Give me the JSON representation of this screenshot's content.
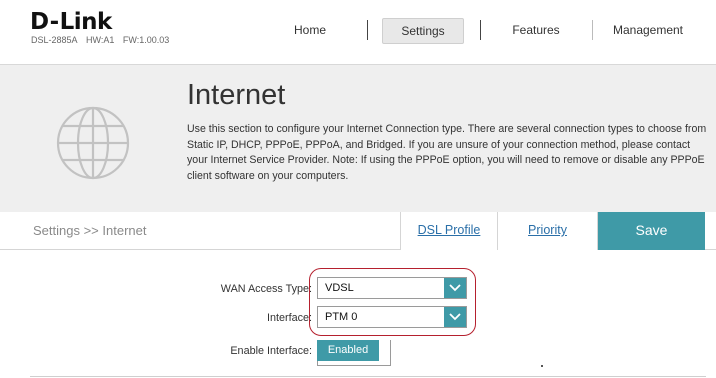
{
  "header": {
    "brand_name": "D",
    "brand_dash": "-",
    "brand_rest": "Link",
    "model": "DSL-2885A",
    "hardware": "HW:A1",
    "firmware": "FW:1.00.03"
  },
  "nav": {
    "items": [
      {
        "label": "Home",
        "active": false
      },
      {
        "label": "Settings",
        "active": true
      },
      {
        "label": "Features",
        "active": false
      },
      {
        "label": "Management",
        "active": false
      }
    ]
  },
  "banner": {
    "icon": "globe-icon",
    "title": "Internet",
    "description": "Use this section to configure your Internet Connection type. There are several connection types to choose from Static IP, DHCP, PPPoE, PPPoA, and Bridged. If you are unsure of your connection method, please contact your Internet Service Provider. Note: If using the PPPoE option, you will need to remove or disable any PPPoE client software on your computers."
  },
  "subbar": {
    "breadcrumb": "Settings >> Internet",
    "tabs": [
      {
        "label": "DSL Profile"
      },
      {
        "label": "Priority"
      }
    ],
    "save_label": "Save"
  },
  "form": {
    "wan_access_type": {
      "label": "WAN Access Type:",
      "value": "VDSL"
    },
    "interface": {
      "label": "Interface:",
      "value": "PTM 0"
    },
    "enable_interface": {
      "label": "Enable Interface:",
      "value": "Enabled",
      "on": true
    }
  },
  "colors": {
    "accent": "#3f9aa7",
    "link": "#2a6fa8",
    "highlight_ring": "#b5202e",
    "banner_bg": "#efefef"
  }
}
